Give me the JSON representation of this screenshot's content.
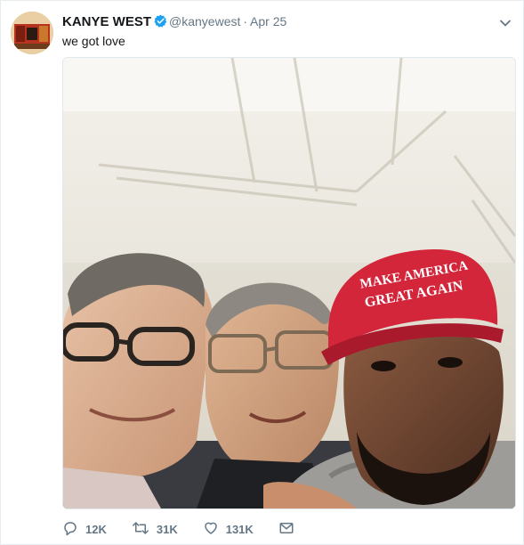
{
  "tweet": {
    "display_name": "KANYE WEST",
    "handle": "@kanyewest",
    "separator": "·",
    "date": "Apr 25",
    "text": "we got love",
    "verified_icon": "verified-badge-icon",
    "menu_icon": "chevron-down-icon"
  },
  "media": {
    "hat_line1": "MAKE AMERICA",
    "hat_line2": "GREAT AGAIN"
  },
  "actions": {
    "replies": "12K",
    "retweets": "31K",
    "likes": "131K"
  },
  "colors": {
    "accent": "#1da1f2",
    "muted": "#657786",
    "hat_red": "#d3263a"
  }
}
